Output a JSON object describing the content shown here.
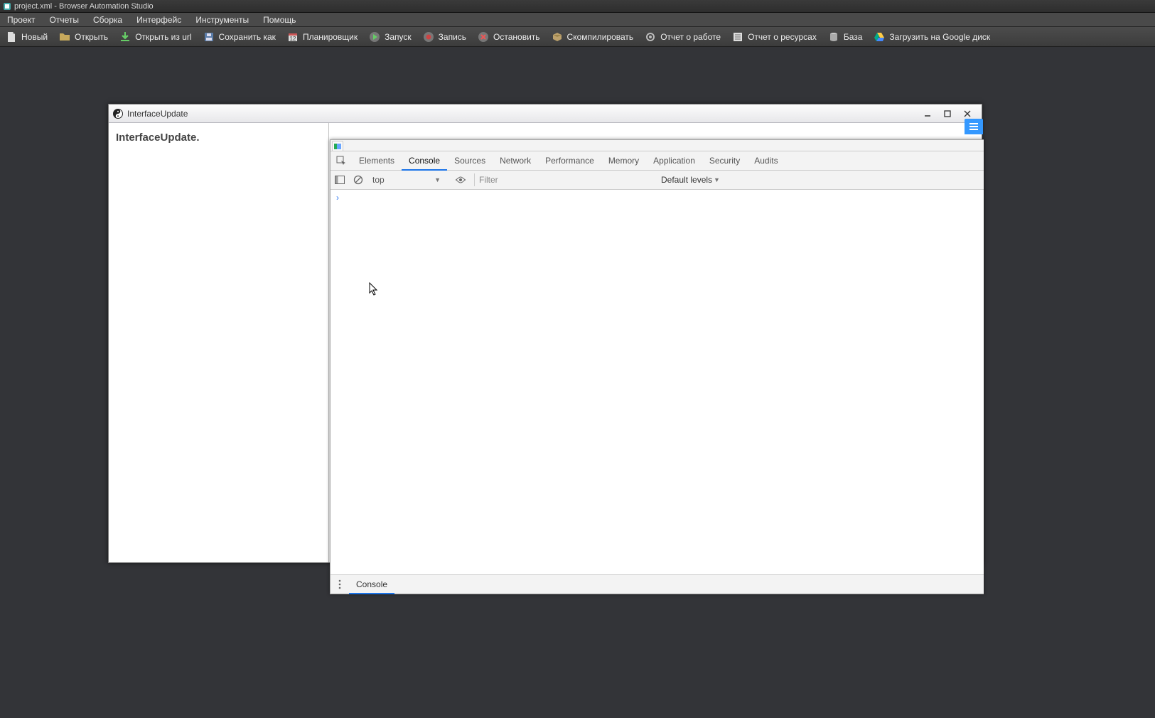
{
  "app": {
    "title": "project.xml - Browser Automation Studio"
  },
  "menubar": {
    "project": "Проект",
    "reports": "Отчеты",
    "build": "Сборка",
    "interface": "Интерфейс",
    "tools": "Инструменты",
    "help": "Помощь"
  },
  "toolbar": {
    "new": "Новый",
    "open": "Открыть",
    "open_url": "Открыть из url",
    "save_as": "Сохранить как",
    "scheduler": "Планировщик",
    "run": "Запуск",
    "record": "Запись",
    "stop": "Остановить",
    "compile": "Скомпилировать",
    "work_report": "Отчет о работе",
    "res_report": "Отчет о ресурсах",
    "database": "База",
    "gdrive": "Загрузить на Google диск"
  },
  "inner": {
    "title": "InterfaceUpdate",
    "heading": "InterfaceUpdate."
  },
  "devtools": {
    "tabs": {
      "elements": "Elements",
      "console": "Console",
      "sources": "Sources",
      "network": "Network",
      "performance": "Performance",
      "memory": "Memory",
      "application": "Application",
      "security": "Security",
      "audits": "Audits"
    },
    "active_tab": "console",
    "context": "top",
    "filter_placeholder": "Filter",
    "levels": "Default levels",
    "prompt": "›",
    "drawer_tab": "Console"
  }
}
